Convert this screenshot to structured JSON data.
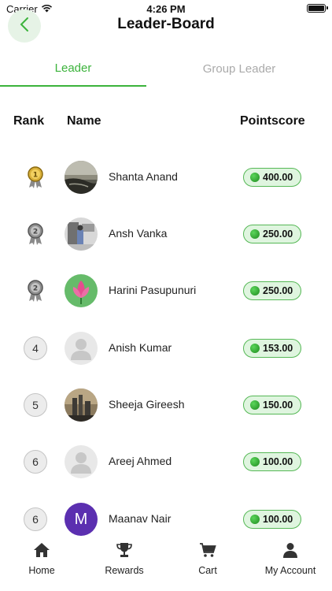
{
  "status_bar": {
    "carrier": "Carrier",
    "time": "4:26 PM"
  },
  "header": {
    "title": "Leader-Board"
  },
  "tabs": [
    {
      "label": "Leader",
      "active": true
    },
    {
      "label": "Group Leader",
      "active": false
    }
  ],
  "columns": {
    "rank": "Rank",
    "name": "Name",
    "points": "Pointscore"
  },
  "rows": [
    {
      "rank": "1",
      "rank_type": "medal-gold",
      "name": "Shanta Anand",
      "points": "400.00",
      "avatar": "photo-landscape"
    },
    {
      "rank": "2",
      "rank_type": "medal-silver",
      "name": "Ansh Vanka",
      "points": "250.00",
      "avatar": "photo-room"
    },
    {
      "rank": "2",
      "rank_type": "medal-silver",
      "name": "Harini Pasupunuri",
      "points": "250.00",
      "avatar": "lotus-flower"
    },
    {
      "rank": "4",
      "rank_type": "circle",
      "name": "Anish Kumar",
      "points": "153.00",
      "avatar": "default-user"
    },
    {
      "rank": "5",
      "rank_type": "circle",
      "name": "Sheeja Gireesh",
      "points": "150.00",
      "avatar": "photo-city"
    },
    {
      "rank": "6",
      "rank_type": "circle",
      "name": "Areej Ahmed",
      "points": "100.00",
      "avatar": "default-user"
    },
    {
      "rank": "6",
      "rank_type": "circle",
      "name": "Maanav Nair",
      "points": "100.00",
      "avatar": "initial",
      "initial": "M"
    }
  ],
  "nav": [
    {
      "label": "Home",
      "icon": "home-icon"
    },
    {
      "label": "Rewards",
      "icon": "trophy-icon"
    },
    {
      "label": "Cart",
      "icon": "cart-icon"
    },
    {
      "label": "My Account",
      "icon": "account-icon"
    }
  ],
  "colors": {
    "accent": "#3bb33b",
    "points_bg": "#dff5df",
    "initial_avatar": "#5b2fb0"
  }
}
